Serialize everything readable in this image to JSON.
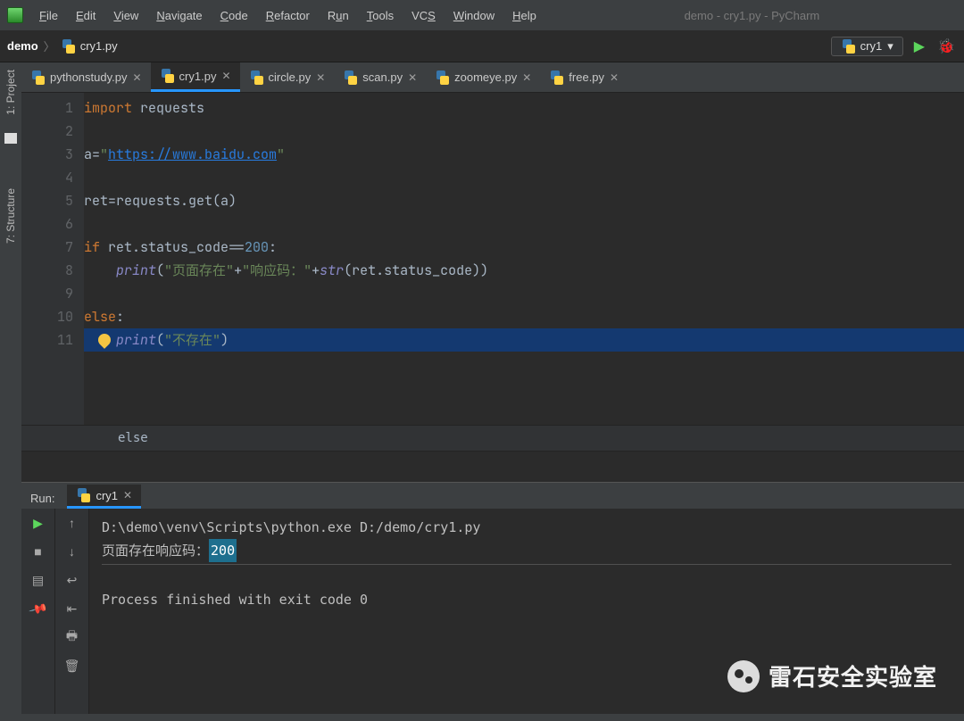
{
  "menus": [
    "File",
    "Edit",
    "View",
    "Navigate",
    "Code",
    "Refactor",
    "Run",
    "Tools",
    "VCS",
    "Window",
    "Help"
  ],
  "window_title": "demo - cry1.py - PyCharm",
  "breadcrumb": {
    "project": "demo",
    "file": "cry1.py"
  },
  "run_config": {
    "name": "cry1"
  },
  "side": {
    "project_label": "1: Project",
    "structure_label": "7: Structure"
  },
  "tabs": [
    {
      "label": "pythonstudy.py",
      "active": false
    },
    {
      "label": "cry1.py",
      "active": true
    },
    {
      "label": "circle.py",
      "active": false
    },
    {
      "label": "scan.py",
      "active": false
    },
    {
      "label": "zoomeye.py",
      "active": false
    },
    {
      "label": "free.py",
      "active": false
    }
  ],
  "line_numbers": [
    1,
    2,
    3,
    4,
    5,
    6,
    7,
    8,
    9,
    10,
    11
  ],
  "code": {
    "l1": {
      "kw": "import",
      "rest": " requests"
    },
    "l3": {
      "pre": "a=",
      "q": "\"",
      "link": "https://www.baidu.com",
      "q2": "\""
    },
    "l5": {
      "text": "ret=requests.get(a)"
    },
    "l7": {
      "kw": "if",
      "mid": " ret.status_code==",
      "num": "200",
      "tail": ":"
    },
    "l8": {
      "indent": "    ",
      "fn": "print",
      "open": "(",
      "s1": "\"页面存在\"",
      "plus1": "+",
      "s2": "\"响应码：\"",
      "plus2": "+",
      "str_fn": "str",
      "args": "(ret.status_code))"
    },
    "l10": {
      "kw": "else",
      "tail": ":"
    },
    "l11": {
      "indent": "    ",
      "fn": "print",
      "open": "(",
      "s": "\"不存在\"",
      "close": ")"
    }
  },
  "context_line": "else",
  "run": {
    "label": "Run:",
    "tab": "cry1",
    "cmd": "D:\\demo\\venv\\Scripts\\python.exe D:/demo/cry1.py",
    "out_prefix": "页面存在响应码：",
    "out_code": "200",
    "exit": "Process finished with exit code 0"
  },
  "watermark": "雷石安全实验室"
}
